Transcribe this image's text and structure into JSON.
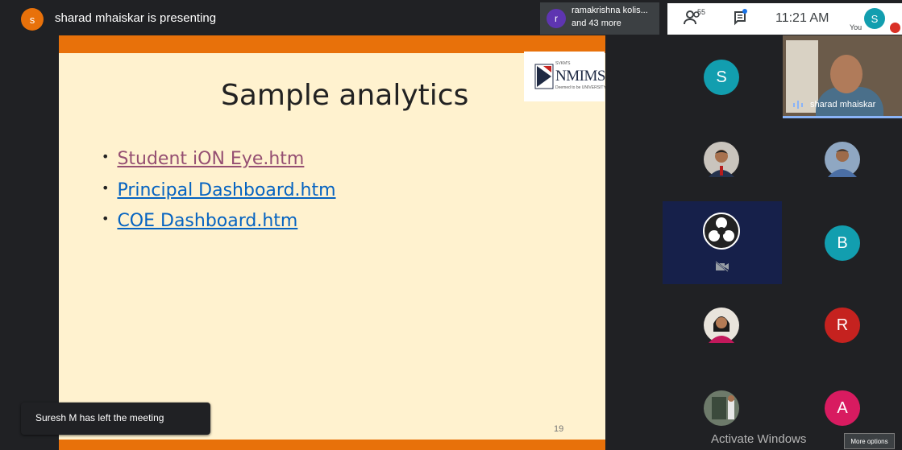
{
  "topbar": {
    "presenter_initial": "s",
    "presenting_text": "sharad mhaiskar is presenting",
    "people_chip": {
      "initial": "r",
      "line1": "ramakrishna kolis...",
      "line2": "and 43 more"
    },
    "people_count": "55",
    "clock": "11:21 AM",
    "you_label": "You",
    "you_initial": "S"
  },
  "slide": {
    "title": "Sample analytics",
    "bullets": [
      {
        "label": "Student iON Eye.htm",
        "color": "#954f72"
      },
      {
        "label": "Principal Dashboard.htm",
        "color": "#0563c1"
      },
      {
        "label": "COE Dashboard.htm",
        "color": "#0563c1"
      }
    ],
    "page_number": "19",
    "logo": {
      "brand": "NMIMS",
      "small": "SVKM'S",
      "sub": "Deemed to be UNIVERSITY"
    }
  },
  "toast": {
    "text": "Suresh M has left the meeting"
  },
  "participants": {
    "self_name": "sharad mhaiskar",
    "tiles": [
      {
        "initial": "S",
        "color": "#129eaf"
      },
      {
        "initial": "B",
        "color": "#129eaf"
      },
      {
        "initial": "R",
        "color": "#c5221f"
      },
      {
        "initial": "A",
        "color": "#d81b60"
      }
    ]
  },
  "watermark": "Activate Windows",
  "more_options": "More options"
}
